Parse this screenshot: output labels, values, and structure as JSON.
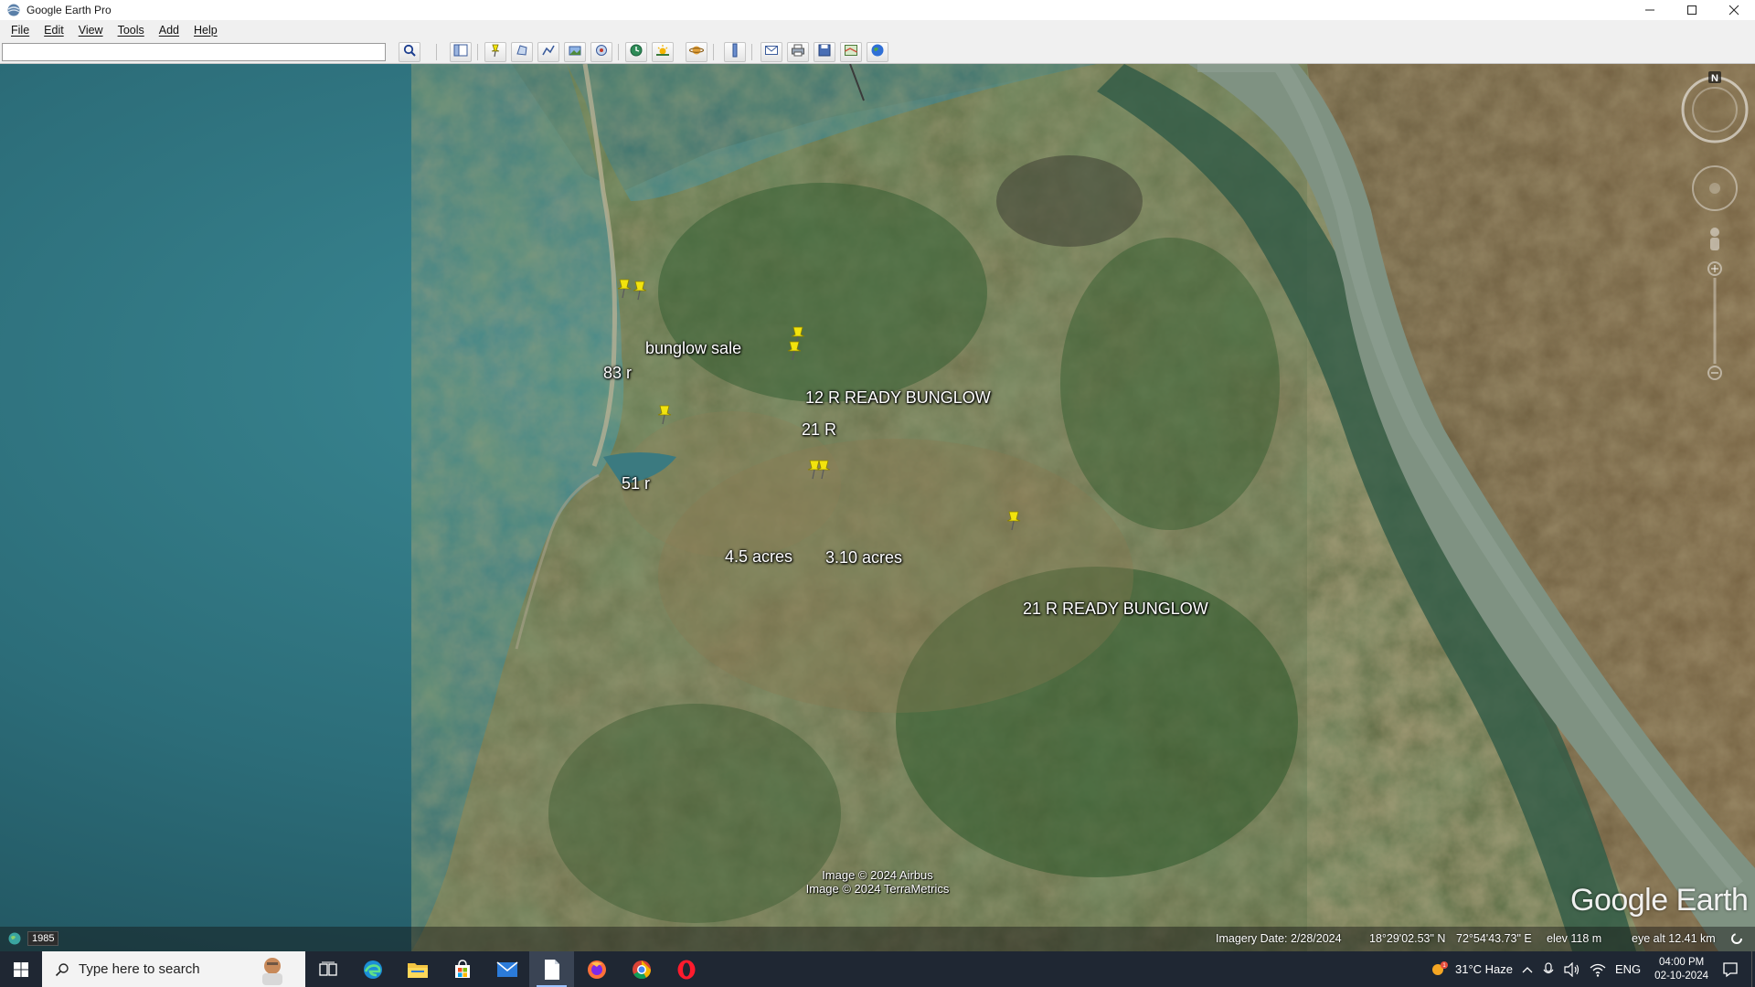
{
  "window": {
    "title": "Google Earth Pro",
    "controls": [
      "minimize",
      "maximize",
      "close"
    ]
  },
  "menu": {
    "items": [
      {
        "label": "File"
      },
      {
        "label": "Edit"
      },
      {
        "label": "View"
      },
      {
        "label": "Tools"
      },
      {
        "label": "Add"
      },
      {
        "label": "Help"
      }
    ]
  },
  "search": {
    "value": "",
    "placeholder": ""
  },
  "toolbar": {
    "icons": [
      "sidebar-icon",
      "placemark-icon",
      "polygon-icon",
      "path-icon",
      "image-overlay-icon",
      "tour-icon",
      "historical-imagery-icon",
      "sunlight-icon",
      "planets-icon",
      "ruler-icon",
      "email-icon",
      "print-icon",
      "save-image-icon",
      "maps-icon",
      "earth-view-icon"
    ]
  },
  "placemarks": [
    {
      "label": "bunglow sale"
    },
    {
      "label": "83 r"
    },
    {
      "label": "12 R READY BUNGLOW"
    },
    {
      "label": "21 R"
    },
    {
      "label": "51 r"
    },
    {
      "label": "4.5 acres"
    },
    {
      "label": "3.10 acres"
    },
    {
      "label": "21 R READY BUNGLOW"
    }
  ],
  "attribution": {
    "line1": "Image © 2024 Airbus",
    "line2": "Image © 2024 TerraMetrics"
  },
  "logo": {
    "text": "Google Earth"
  },
  "compass": {
    "north_label": "N"
  },
  "status": {
    "year": "1985",
    "imagery_date": "Imagery Date: 2/28/2024",
    "lat": "18°29'02.53\" N",
    "lon": "72°54'43.73\" E",
    "elev": "elev   118 m",
    "eye_alt": "eye alt  12.41 km"
  },
  "taskbar": {
    "search_placeholder": "Type here to search",
    "apps": [
      "task-view-icon",
      "edge-icon",
      "file-explorer-icon",
      "store-icon",
      "mail-icon",
      "google-earth-icon",
      "firefox-icon",
      "chrome-icon",
      "opera-icon"
    ],
    "weather": "31°C  Haze",
    "language": "ENG",
    "time": "04:00 PM",
    "date": "02-10-2024"
  },
  "colors": {
    "sea": "#2f6f7a",
    "land": "#5a6a3c",
    "river": "#7f9282",
    "taskbar": "#1f2733",
    "placemark": "#f2e30d"
  }
}
